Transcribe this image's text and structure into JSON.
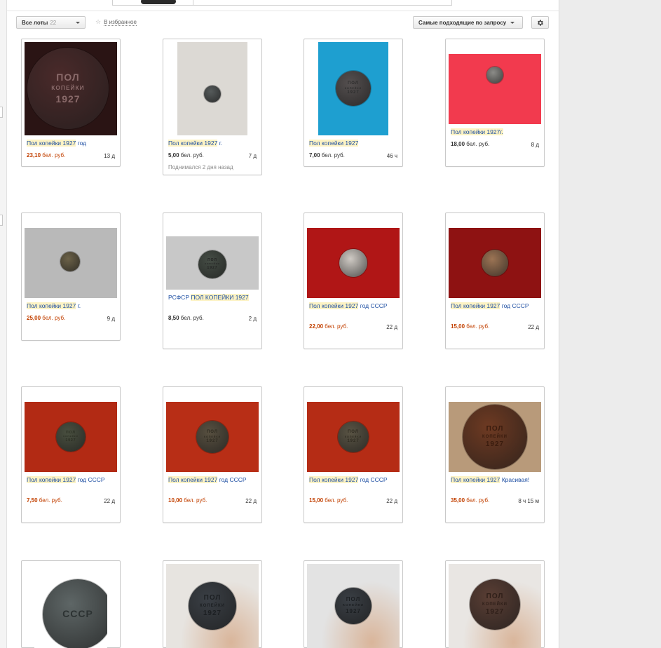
{
  "toolbar": {
    "lots_label": "Все лоты",
    "lots_count": "22",
    "favorite_label": "В избранное",
    "sort_label": "Самые подходящие по запросу"
  },
  "coin_text": [
    "ПОЛ",
    "КОПЕЙКИ",
    "1927",
    "СССР"
  ],
  "lots": [
    {
      "title_hl": "Пол копейки 1927",
      "title_rest": " год",
      "price": "23,10",
      "currency": "бел. руб.",
      "time": "13 д",
      "price_color": "orange",
      "bg": "#2a1414"
    },
    {
      "title_hl": "Пол копейки 1927",
      "title_rest": " г.",
      "price": "5,00",
      "currency": "бел. руб.",
      "time": "7 д",
      "price_color": "dark",
      "note": "Поднимался 2 дня назад",
      "bg": "#dcd9d4"
    },
    {
      "title_hl": "Пол копейки 1927",
      "title_rest": "",
      "price": "7,00",
      "currency": "бел. руб.",
      "time": "46 ч",
      "price_color": "dark",
      "bg": "#1e9fd0"
    },
    {
      "title_hl": "Пол копейки 1927г.",
      "title_rest": "",
      "price": "18,00",
      "currency": "бел. руб.",
      "time": "8 д",
      "price_color": "dark",
      "bg": "#f23a4e"
    },
    {
      "title_hl": "Пол копейки 1927",
      "title_rest": " г.",
      "price": "25,00",
      "currency": "бел. руб.",
      "time": "9 д",
      "price_color": "orange",
      "bg": "#b9b9b9"
    },
    {
      "title_pre": "РСФСР ",
      "title_hl": "ПОЛ КОПЕЙКИ 1927",
      "title_rest": "",
      "price": "8,50",
      "currency": "бел. руб.",
      "time": "2 д",
      "price_color": "dark",
      "bg": "#c8c8c8"
    },
    {
      "title_hl": "Пол копейки 1927",
      "title_rest": " год СССР",
      "price": "22,00",
      "currency": "бел. руб.",
      "time": "22 д",
      "price_color": "orange",
      "bg": "#b01616"
    },
    {
      "title_hl": "Пол копейки 1927",
      "title_rest": " год СССР",
      "price": "15,00",
      "currency": "бел. руб.",
      "time": "22 д",
      "price_color": "orange",
      "bg": "#8e1212"
    },
    {
      "title_hl": "Пол копейки 1927",
      "title_rest": " год СССР",
      "price": "7,50",
      "currency": "бел. руб.",
      "time": "22 д",
      "price_color": "orange",
      "bg": "#b22a14"
    },
    {
      "title_hl": "Пол копейки 1927",
      "title_rest": " год СССР",
      "price": "10,00",
      "currency": "бел. руб.",
      "time": "22 д",
      "price_color": "orange",
      "bg": "#b82e16"
    },
    {
      "title_hl": "Пол копейки 1927",
      "title_rest": " год СССР",
      "price": "15,00",
      "currency": "бел. руб.",
      "time": "22 д",
      "price_color": "orange",
      "bg": "#b52c15"
    },
    {
      "title_hl": "Пол копейки 1927",
      "title_rest": " Красивая!",
      "price": "35,00",
      "currency": "бел. руб.",
      "time": "8 ч 15 м",
      "price_color": "orange",
      "bg": "#b89a7a"
    },
    {
      "bg": "#ffffff"
    },
    {
      "bg": "#e7e4e0"
    },
    {
      "bg": "#e3e3e3"
    },
    {
      "bg": "#e9e6e3"
    }
  ]
}
